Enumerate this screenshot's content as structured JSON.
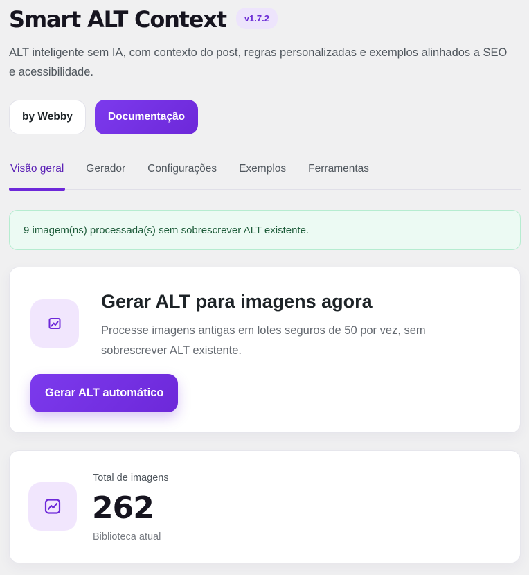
{
  "header": {
    "title": "Smart ALT Context",
    "version": "v1.7.2",
    "subtitle": "ALT inteligente sem IA, com contexto do post, regras personalizadas e exemplos alinhados a SEO e acessibilidade."
  },
  "buttons": {
    "by_webby": "by Webby",
    "documentation": "Documentação"
  },
  "tabs": [
    {
      "label": "Visão geral",
      "active": true
    },
    {
      "label": "Gerador",
      "active": false
    },
    {
      "label": "Configurações",
      "active": false
    },
    {
      "label": "Exemplos",
      "active": false
    },
    {
      "label": "Ferramentas",
      "active": false
    }
  ],
  "notice": {
    "text": "9 imagem(ns) processada(s) sem sobrescrever ALT existente."
  },
  "generate_card": {
    "icon": "image-chart-icon",
    "title": "Gerar ALT para imagens agora",
    "description": "Processe imagens antigas em lotes seguros de 50 por vez, sem sobrescrever ALT existente.",
    "button": "Gerar ALT automático"
  },
  "stats_card": {
    "icon": "image-chart-icon",
    "label": "Total de imagens",
    "value": "262",
    "sub": "Biblioteca atual"
  },
  "colors": {
    "accent": "#6d28d9",
    "accent_light": "#f1e6fd",
    "success_bg": "#ecfaf3",
    "success_text": "#1e5c3a"
  }
}
